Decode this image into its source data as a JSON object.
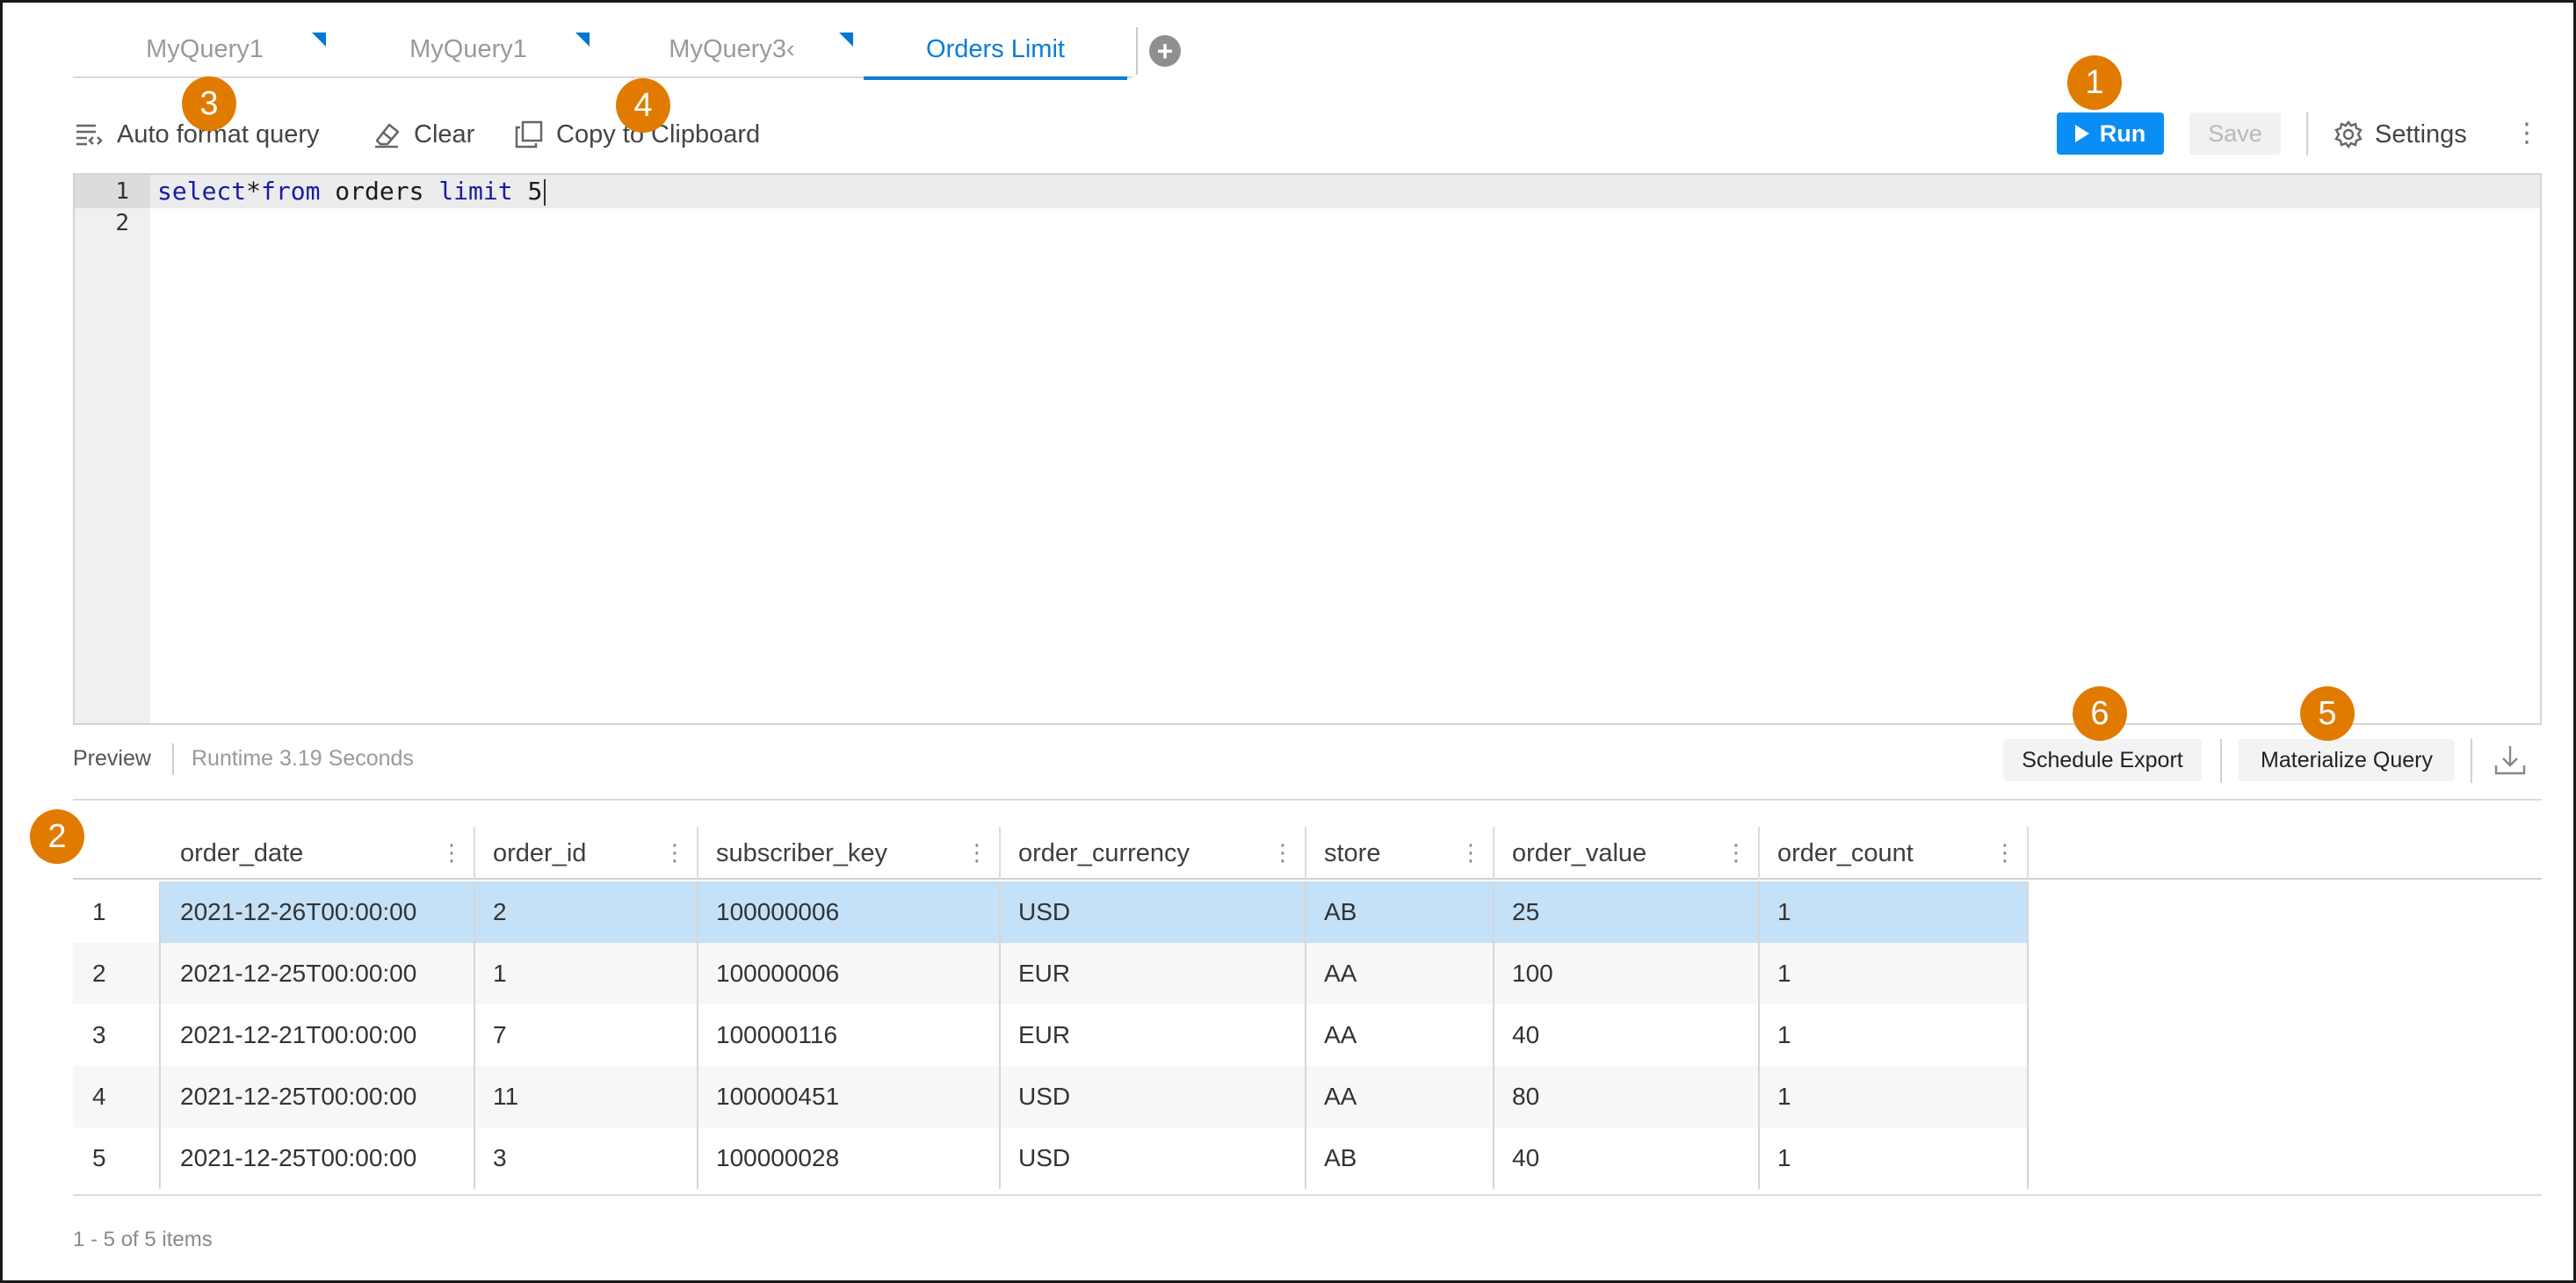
{
  "tabs": [
    {
      "label": "MyQuery1",
      "active": false,
      "modified": true
    },
    {
      "label": "MyQuery1",
      "active": false,
      "modified": true
    },
    {
      "label": "MyQuery3‹",
      "active": false,
      "modified": true
    },
    {
      "label": "Orders Limit",
      "active": true,
      "modified": false
    }
  ],
  "add_tab_icon": "plus-circle-icon",
  "toolbar": {
    "auto_format_label": "Auto format query",
    "clear_label": "Clear",
    "copy_label": "Copy to Clipboard",
    "run_label": "Run",
    "save_label": "Save",
    "settings_label": "Settings",
    "more_icon": "kebab-icon"
  },
  "editor": {
    "line_numbers": [
      "1",
      "2"
    ],
    "tokens": [
      {
        "text": "select",
        "kw": true
      },
      {
        "text": "*",
        "kw": false
      },
      {
        "text": "from",
        "kw": true
      },
      {
        "text": " orders ",
        "kw": false
      },
      {
        "text": "limit",
        "kw": true
      },
      {
        "text": " 5",
        "kw": false
      }
    ]
  },
  "preview": {
    "label": "Preview",
    "runtime": "Runtime 3.19 Seconds",
    "schedule_export_label": "Schedule Export",
    "materialize_label": "Materialize Query",
    "download_icon": "download-icon"
  },
  "table": {
    "columns": [
      "order_date",
      "order_id",
      "subscriber_key",
      "order_currency",
      "store",
      "order_value",
      "order_count"
    ],
    "rows": [
      [
        "2021-12-26T00:00:00",
        "2",
        "100000006",
        "USD",
        "AB",
        "25",
        "1"
      ],
      [
        "2021-12-25T00:00:00",
        "1",
        "100000006",
        "EUR",
        "AA",
        "100",
        "1"
      ],
      [
        "2021-12-21T00:00:00",
        "7",
        "100000116",
        "EUR",
        "AA",
        "40",
        "1"
      ],
      [
        "2021-12-25T00:00:00",
        "11",
        "100000451",
        "USD",
        "AA",
        "80",
        "1"
      ],
      [
        "2021-12-25T00:00:00",
        "3",
        "100000028",
        "USD",
        "AB",
        "40",
        "1"
      ]
    ],
    "row_numbers": [
      "1",
      "2",
      "3",
      "4",
      "5"
    ],
    "selected_row": 0,
    "footer": "1 - 5 of 5 items"
  },
  "badges": [
    "1",
    "2",
    "3",
    "4",
    "5",
    "6"
  ],
  "colors": {
    "accent": "#0b7dd6",
    "run_button": "#0b8ef3",
    "badge": "#e07b00",
    "selected_row": "#c5e1f8",
    "keyword": "#1a1aa6"
  }
}
